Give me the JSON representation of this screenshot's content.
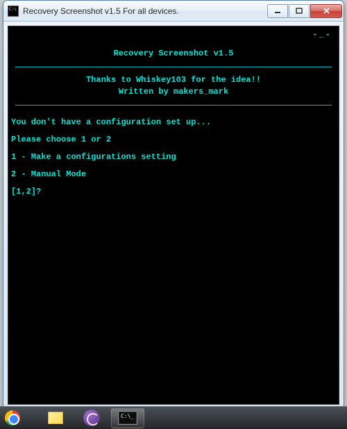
{
  "window": {
    "title": "Recovery Screenshot v1.5 For all devices."
  },
  "console": {
    "top_dash": "-_-",
    "heading": "Recovery Screenshot v1.5",
    "credits_line1": "Thanks to Whiskey103 for the idea!!",
    "credits_line2": "Written by makers_mark",
    "msg_noconfig": "You don't have a configuration set up...",
    "msg_choose": "Please choose 1 or 2",
    "opt1": "1 - Make a configurations setting",
    "opt2": "2 - Manual Mode",
    "prompt": "[1,2]?"
  },
  "taskbar": {
    "items": [
      {
        "name": "chrome"
      },
      {
        "name": "sticky-notes"
      },
      {
        "name": "bittorrent"
      },
      {
        "name": "command-prompt"
      }
    ]
  }
}
